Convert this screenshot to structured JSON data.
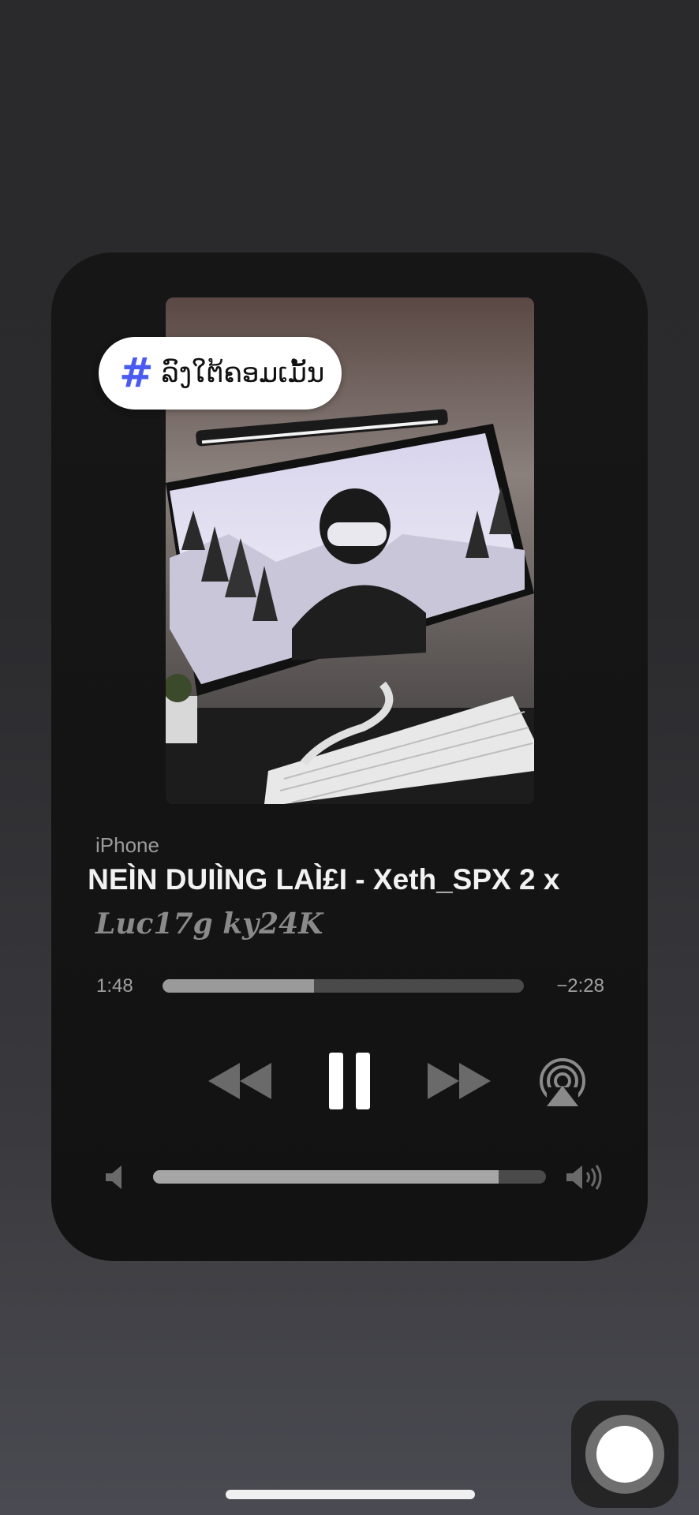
{
  "hashtag": {
    "symbol": "#",
    "text": "ລົງໃຕ້ຄອມເມັ້ນ",
    "accent_color": "#4a5cf0"
  },
  "now_playing": {
    "device": "iPhone",
    "title": "M NEÌN DUIÌNG LAÌ£I - Xeth_SPX 2 x",
    "artist": "Luc17g ky24K",
    "elapsed": "1:48",
    "remaining": "−2:28",
    "progress_fraction": 0.42,
    "volume_fraction": 0.88
  },
  "controls": {
    "rewind_icon": "rewind-icon",
    "pause_icon": "pause-icon",
    "forward_icon": "fast-forward-icon",
    "airplay_icon": "airplay-audio-icon",
    "volume_low_icon": "speaker-low-icon",
    "volume_high_icon": "speaker-high-icon"
  },
  "system": {
    "assistive_touch_icon": "assistive-touch-icon",
    "home_indicator": "home-indicator"
  }
}
